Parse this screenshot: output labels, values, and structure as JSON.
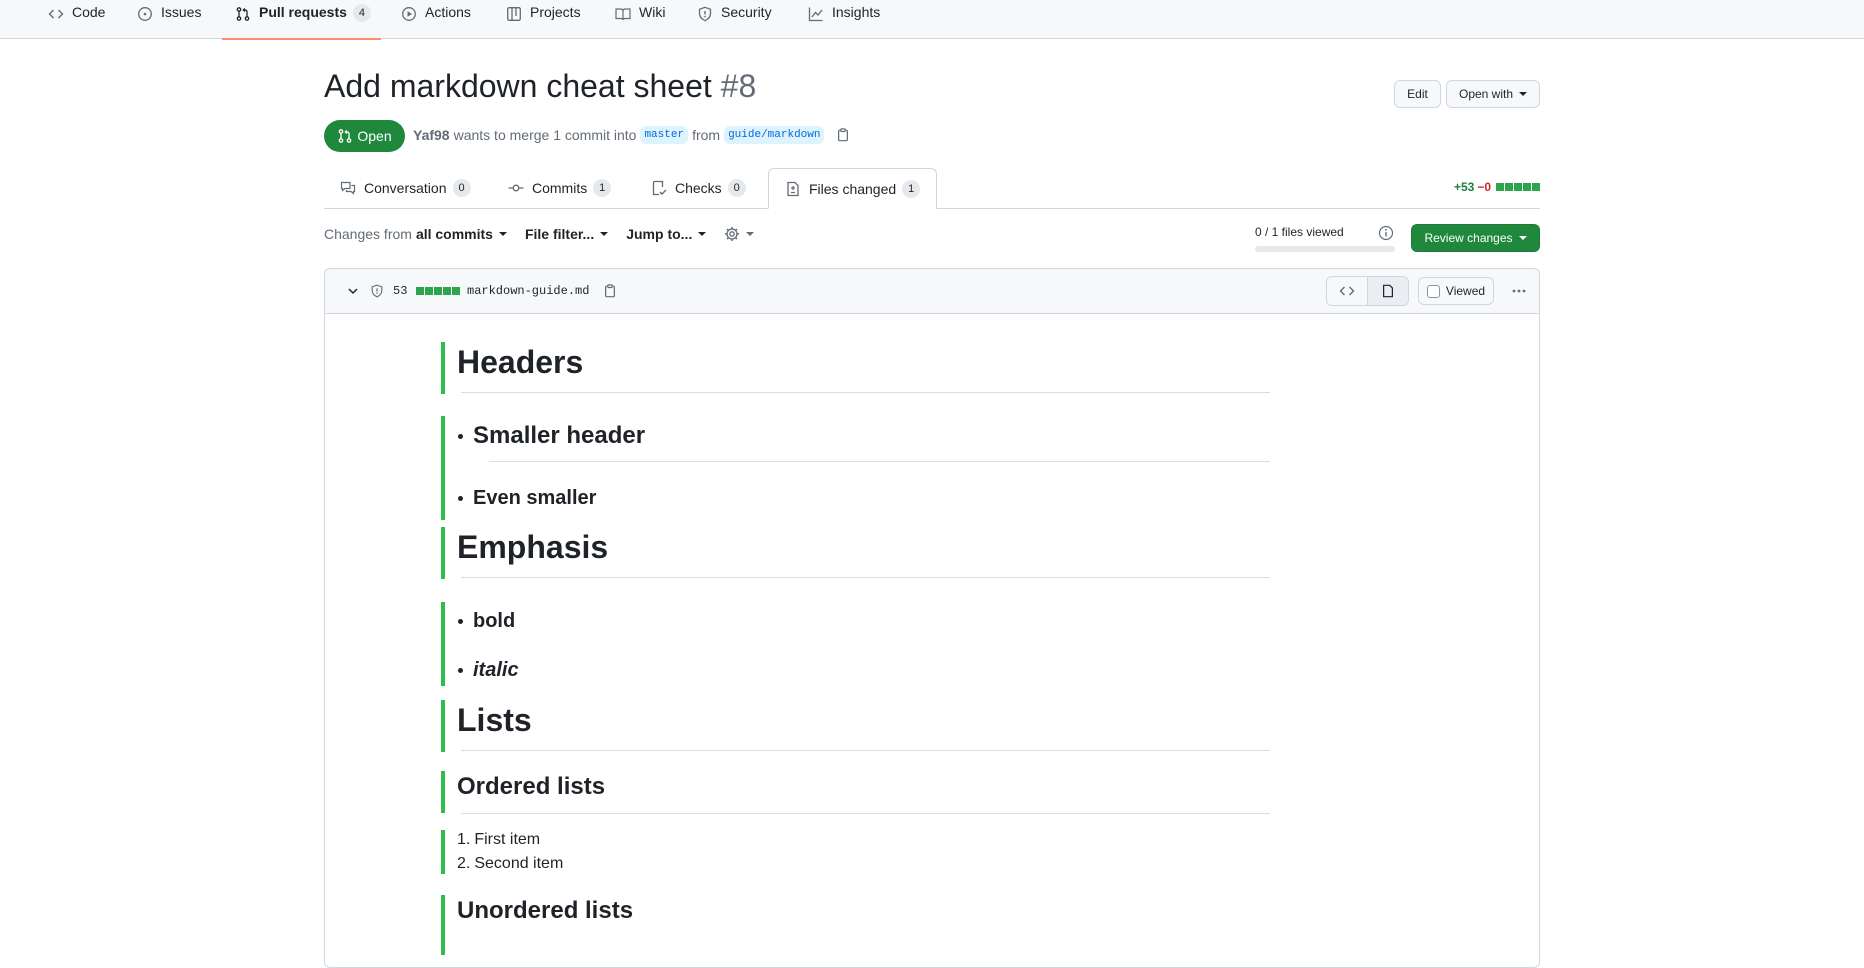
{
  "repo_nav": {
    "items": [
      {
        "label": "Code",
        "icon": "code-icon"
      },
      {
        "label": "Issues",
        "icon": "issue-opened-icon"
      },
      {
        "label": "Pull requests",
        "icon": "git-pull-request-icon",
        "count": "4",
        "selected": true
      },
      {
        "label": "Actions",
        "icon": "play-icon"
      },
      {
        "label": "Projects",
        "icon": "table-icon"
      },
      {
        "label": "Wiki",
        "icon": "book-icon"
      },
      {
        "label": "Security",
        "icon": "shield-icon"
      },
      {
        "label": "Insights",
        "icon": "graph-icon"
      }
    ]
  },
  "pr": {
    "title": "Add markdown cheat sheet",
    "number": "#8",
    "edit_label": "Edit",
    "open_with_label": "Open with",
    "state": "Open",
    "author": "Yaf98",
    "meta_text": "wants to merge 1 commit into",
    "base_branch": "master",
    "from_text": "from",
    "head_branch": "guide/markdown"
  },
  "tabs": [
    {
      "label": "Conversation",
      "count": "0",
      "icon": "comment-discussion-icon"
    },
    {
      "label": "Commits",
      "count": "1",
      "icon": "git-commit-icon"
    },
    {
      "label": "Checks",
      "count": "0",
      "icon": "checklist-icon"
    },
    {
      "label": "Files changed",
      "count": "1",
      "icon": "file-diff-icon",
      "active": true
    }
  ],
  "diffstat": {
    "additions": "+53",
    "deletions": "−0"
  },
  "toolbar": {
    "changes_from_prefix": "Changes from",
    "changes_from_value": "all commits",
    "file_filter": "File filter...",
    "jump_to": "Jump to...",
    "files_viewed": "0 / 1 files viewed",
    "files_viewed_fraction": 0,
    "review_button": "Review changes"
  },
  "file": {
    "changes": "53",
    "name": "markdown-guide.md",
    "viewed_label": "Viewed"
  },
  "rendered": {
    "h_headers": "Headers",
    "li_smaller_header": "Smaller header",
    "li_even_smaller": "Even smaller",
    "h_emphasis": "Emphasis",
    "li_bold": "bold",
    "li_italic": "italic",
    "h_lists": "Lists",
    "h_ordered": "Ordered lists",
    "ol_1_num": "1.",
    "ol_1": "First item",
    "ol_2_num": "2.",
    "ol_2": "Second item",
    "h_unordered": "Unordered lists"
  },
  "colors": {
    "accent_green": "#1f883d",
    "diff_add_bar": "#2cbe4e",
    "tab_underline": "#fd8c73",
    "link": "#0969da"
  }
}
